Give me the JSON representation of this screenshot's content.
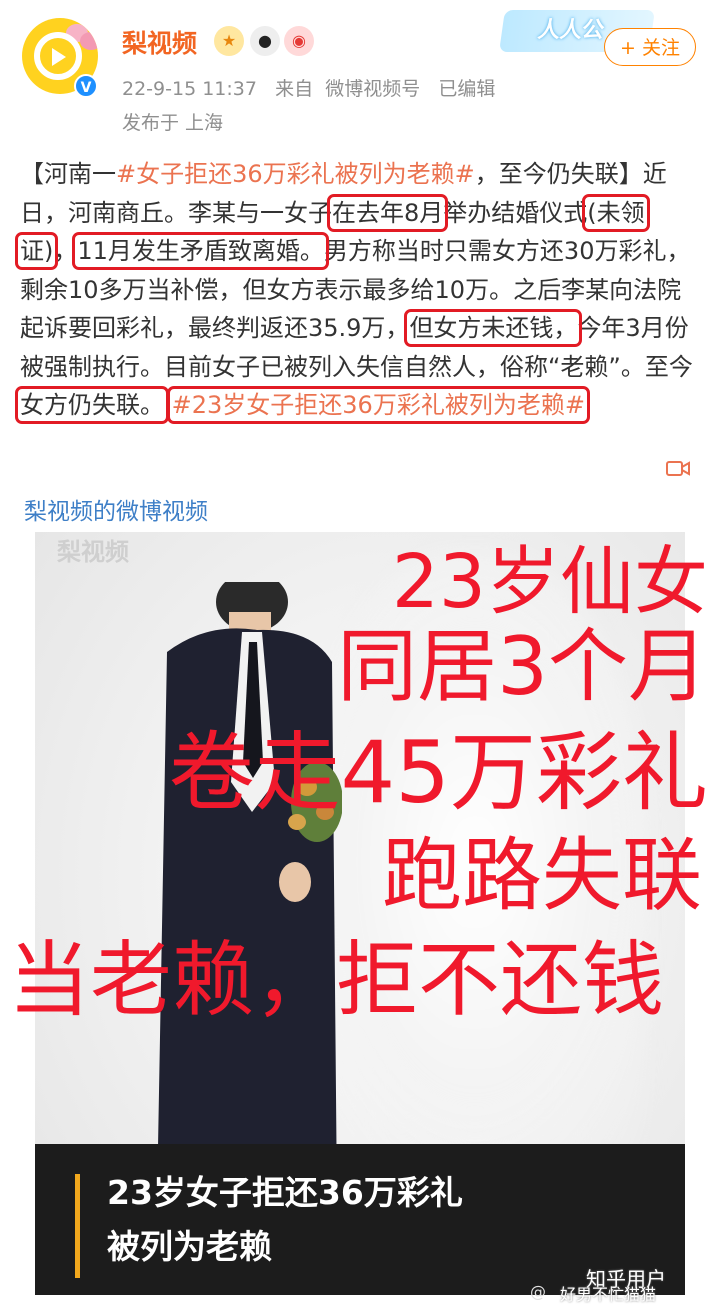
{
  "header": {
    "username": "梨视频",
    "badges": [
      "medal-icon",
      "panda-icon",
      "fire-badge-icon"
    ],
    "follow_deco_text": "人人公",
    "follow_label": "+ 关注",
    "timestamp": "22-9-15 11:37",
    "source_prefix": "来自",
    "source": "微博视频号",
    "edited": "已编辑",
    "location": "发布于 上海"
  },
  "post": {
    "p1": "【河南一",
    "tag1": "#女子拒还36万彩礼被列为老赖#",
    "p2": "，至今仍失联】近日，河南商丘。李某与一女子",
    "h1": "在去年8月",
    "p3": "举办结婚仪式",
    "h2": "(未领证)",
    "p4": "，",
    "h3": "11月发生矛盾致离婚。",
    "p5": "男方称当时只需女方还30万彩礼，剩余10多万当补偿，但女方表示最多给10万。之后李某向法院起诉要回彩礼，最终判返还35.9万，",
    "h4": "但女方未还钱，",
    "p6": "今年3月份被强制执行。目前女子已被列入失信自然人，俗称“老赖”。至今",
    "h5": "女方仍失联。",
    "tag2": "#23岁女子拒还36万彩礼被列为老赖#",
    "video_link": "梨视频的微博视频"
  },
  "video": {
    "watermark": "梨视频",
    "caption_line1": "23岁女子拒还36万彩礼",
    "caption_line2": "被列为老赖"
  },
  "overlay": {
    "line1": "23岁仙女",
    "line2": "同居3个月",
    "line3": "卷走45万彩礼",
    "line4": "跑路失联",
    "line5": "当老赖，拒不还钱"
  },
  "watermarks": {
    "weibo": "@",
    "zhihu": "知乎用户",
    "zhihu_user": "好男不忙猫猫"
  },
  "colors": {
    "username": "#f26522",
    "follow": "#ff8200",
    "tag": "#eb7350",
    "highlight_box": "#e21b24",
    "overlay_text": "#f0192c",
    "link": "#3e7fc7"
  }
}
